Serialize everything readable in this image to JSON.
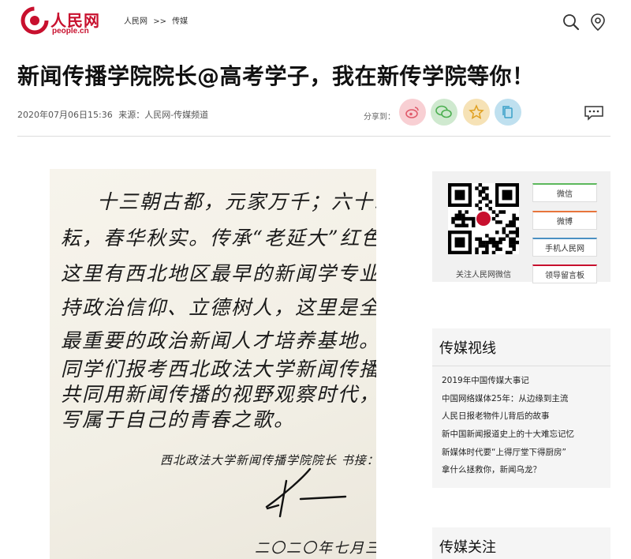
{
  "header": {
    "logo_cn": "人民网",
    "logo_en": "people.cn",
    "breadcrumb": [
      "人民网",
      ">>",
      "传媒"
    ]
  },
  "article": {
    "title": "新闻传播学院院长@高考学子，我在新传学院等你！",
    "date": "2020年07月06日15:36",
    "source": "来源：人民网-传媒频道",
    "share_label": "分享到："
  },
  "letter": {
    "lines": [
      "十三朝古都，元家万千；六十载耕",
      "耘，春华秋实。传承“老延大”红色基因，",
      "这里有西北地区最早的新闻学专业；坚",
      "持政治信仰、立德树人，这里是全国",
      "最重要的政治新闻人才培养基地。欢迎",
      "同学们报考西北政法大学新闻传播学院，",
      "共同用新闻传播的视野观察时代，书",
      "写属于自己的青春之歌。"
    ],
    "signature_line": "西北政法大学新闻传播学院院长 书接：",
    "date_line": "二〇二〇年七月三日"
  },
  "sidebar": {
    "qr_caption": "关注人民网微信",
    "links": [
      {
        "label": "微信",
        "color": "#5cb85c"
      },
      {
        "label": "微博",
        "color": "#e8743b"
      },
      {
        "label": "手机人民网",
        "color": "#4a90c2"
      },
      {
        "label": "领导留言板",
        "color": "#c8102e"
      }
    ],
    "panel1": {
      "title": "传媒视线",
      "items": [
        "2019年中国传媒大事记",
        "中国网络媒体25年：从边缘到主流",
        "人民日报老物件儿背后的故事",
        "新中国新闻报道史上的十大难忘记忆",
        "新媒体时代要“上得厅堂下得厨房”",
        "拿什么拯救你，新闻乌龙？"
      ]
    },
    "panel2": {
      "title": "传媒关注"
    }
  },
  "colors": {
    "brand_red": "#c8102e",
    "weibo_bg": "#f8cfd3",
    "wechat_bg": "#cfe9cf",
    "qzone_bg": "#f6e2b6",
    "copy_bg": "#bfe0ef"
  }
}
